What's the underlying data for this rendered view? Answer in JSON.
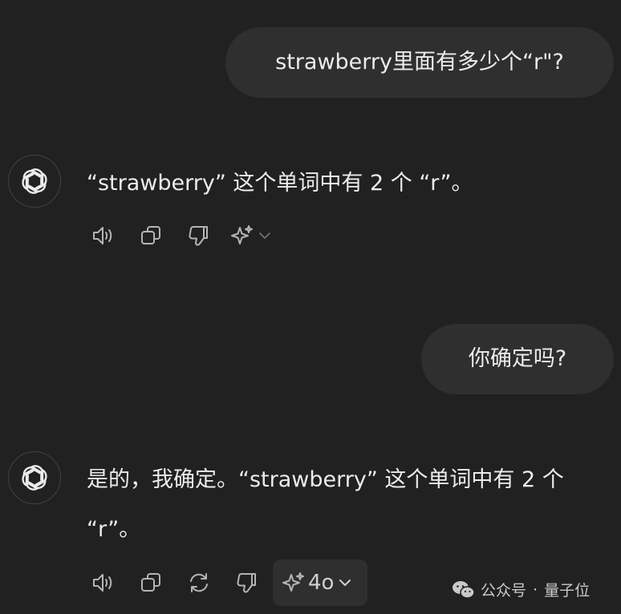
{
  "conversation": {
    "messages": [
      {
        "role": "user",
        "text": "strawberry里面有多少个“r\"?"
      },
      {
        "role": "assistant",
        "text": "“strawberry” 这个单词中有 2 个 “r”。"
      },
      {
        "role": "user",
        "text": "你确定吗?"
      },
      {
        "role": "assistant",
        "text": "是的，我确定。“strawberry” 这个单词中有 2 个 “r”。"
      }
    ]
  },
  "actions": {
    "model_label": "4o",
    "icons": [
      "speaker-icon",
      "copy-icon",
      "regenerate-icon",
      "thumbs-down-icon",
      "sparkle-icon",
      "chevron-down-icon"
    ]
  },
  "watermark": {
    "source": "公众号",
    "separator": "·",
    "name": "量子位"
  },
  "colors": {
    "background": "#212121",
    "user_bubble": "#2f2f2f",
    "text": "#ececec",
    "icon": "#b4b4b4"
  }
}
